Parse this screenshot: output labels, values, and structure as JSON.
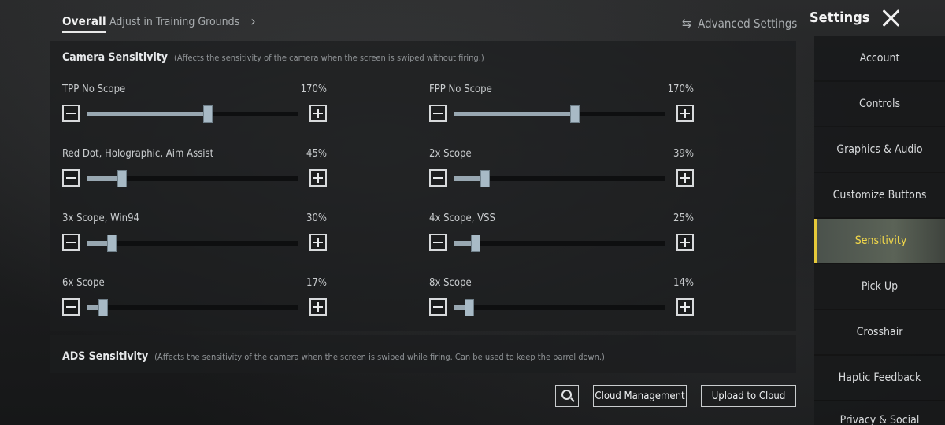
{
  "header": {
    "tab_overall": "Overall",
    "tab_adjust": "Adjust in Training Grounds",
    "chevron": "›",
    "advanced_settings": "Advanced Settings",
    "advanced_icon": "⇆",
    "settings_title": "Settings"
  },
  "camera": {
    "title": "Camera Sensitivity",
    "note": "(Affects the sensitivity of the camera when the screen is swiped without firing.)",
    "sliders": [
      {
        "label": "TPP No Scope",
        "value": "170%",
        "fraction": 0.57
      },
      {
        "label": "FPP No Scope",
        "value": "170%",
        "fraction": 0.57
      },
      {
        "label": "Red Dot, Holographic, Aim Assist",
        "value": "45%",
        "fraction": 0.165
      },
      {
        "label": "2x Scope",
        "value": "39%",
        "fraction": 0.145
      },
      {
        "label": "3x Scope, Win94",
        "value": "30%",
        "fraction": 0.115
      },
      {
        "label": "4x Scope, VSS",
        "value": "25%",
        "fraction": 0.1
      },
      {
        "label": "6x Scope",
        "value": "17%",
        "fraction": 0.075
      },
      {
        "label": "8x Scope",
        "value": "14%",
        "fraction": 0.07
      }
    ]
  },
  "ads": {
    "title": "ADS Sensitivity",
    "note": "(Affects the sensitivity of the camera when the screen is swiped while firing. Can be used to keep the barrel down.)"
  },
  "footer": {
    "cloud_management": "Cloud Management",
    "upload_to_cloud": "Upload to Cloud"
  },
  "sidebar": {
    "items": [
      {
        "label": "Account",
        "active": false
      },
      {
        "label": "Controls",
        "active": false
      },
      {
        "label": "Graphics & Audio",
        "active": false
      },
      {
        "label": "Customize Buttons",
        "active": false
      },
      {
        "label": "Sensitivity",
        "active": true
      },
      {
        "label": "Pick Up",
        "active": false
      },
      {
        "label": "Crosshair",
        "active": false
      },
      {
        "label": "Haptic Feedback",
        "active": false
      },
      {
        "label": "Privacy & Social",
        "active": false
      }
    ]
  },
  "colors": {
    "accent": "#e6c93a",
    "slider_fill": "#98a7b1",
    "slider_thumb": "#a8bac6"
  }
}
